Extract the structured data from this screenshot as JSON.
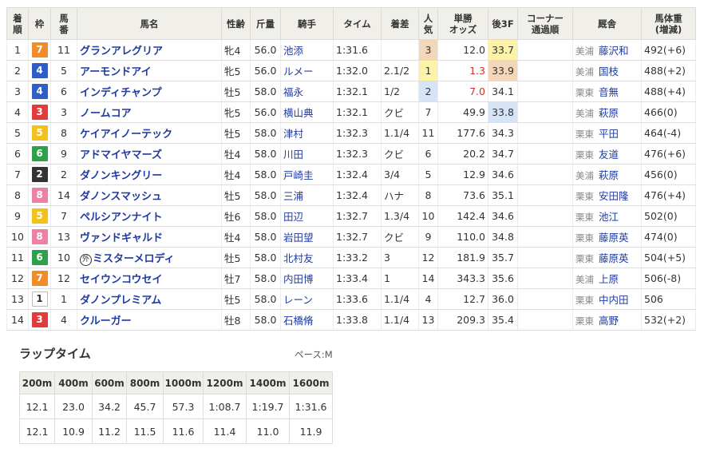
{
  "columns": [
    "着順",
    "枠",
    "馬番",
    "馬名",
    "性齢",
    "斤量",
    "騎手",
    "タイム",
    "着差",
    "人気",
    "単勝オッズ",
    "後3F",
    "コーナー通過順",
    "厩舎",
    "馬体重(増減)"
  ],
  "header_lines": {
    "rank": [
      "着",
      "順"
    ],
    "waku": [
      "枠"
    ],
    "umaban": [
      "馬",
      "番"
    ],
    "horse": [
      "馬名"
    ],
    "sex_age": [
      "性齢"
    ],
    "weight": [
      "斤量"
    ],
    "jockey": [
      "騎手"
    ],
    "time": [
      "タイム"
    ],
    "margin": [
      "着差"
    ],
    "pop": [
      "人",
      "気"
    ],
    "odds": [
      "単勝",
      "オッズ"
    ],
    "last3f": [
      "後3F"
    ],
    "corner": [
      "コーナー",
      "通過順"
    ],
    "trainer": [
      "厩舎"
    ],
    "body": [
      "馬体重",
      "(増減)"
    ]
  },
  "rows": [
    {
      "rank": "1",
      "waku": "7",
      "umaban": "11",
      "horse": "グランアレグリア",
      "marker": "",
      "sex_age": "牝4",
      "weight": "56.0",
      "jockey": "池添",
      "time": "1:31.6",
      "margin": "",
      "pop": "3",
      "odds": "12.0",
      "last3f": "33.7",
      "corner": "",
      "loc": "美浦",
      "trainer": "藤沢和",
      "body": "492(+6)"
    },
    {
      "rank": "2",
      "waku": "4",
      "umaban": "5",
      "horse": "アーモンドアイ",
      "marker": "",
      "sex_age": "牝5",
      "weight": "56.0",
      "jockey": "ルメー",
      "time": "1:32.0",
      "margin": "2.1/2",
      "pop": "1",
      "odds": "1.3",
      "last3f": "33.9",
      "corner": "",
      "loc": "美浦",
      "trainer": "国枝",
      "body": "488(+2)"
    },
    {
      "rank": "3",
      "waku": "4",
      "umaban": "6",
      "horse": "インディチャンプ",
      "marker": "",
      "sex_age": "牡5",
      "weight": "58.0",
      "jockey": "福永",
      "time": "1:32.1",
      "margin": "1/2",
      "pop": "2",
      "odds": "7.0",
      "last3f": "34.1",
      "corner": "",
      "loc": "栗東",
      "trainer": "音無",
      "body": "488(+4)"
    },
    {
      "rank": "4",
      "waku": "3",
      "umaban": "3",
      "horse": "ノームコア",
      "marker": "",
      "sex_age": "牝5",
      "weight": "56.0",
      "jockey": "横山典",
      "time": "1:32.1",
      "margin": "クビ",
      "pop": "7",
      "odds": "49.9",
      "last3f": "33.8",
      "corner": "",
      "loc": "美浦",
      "trainer": "萩原",
      "body": "466(0)"
    },
    {
      "rank": "5",
      "waku": "5",
      "umaban": "8",
      "horse": "ケイアイノーテック",
      "marker": "",
      "sex_age": "牡5",
      "weight": "58.0",
      "jockey": "津村",
      "time": "1:32.3",
      "margin": "1.1/4",
      "pop": "11",
      "odds": "177.6",
      "last3f": "34.3",
      "corner": "",
      "loc": "栗東",
      "trainer": "平田",
      "body": "464(-4)"
    },
    {
      "rank": "6",
      "waku": "6",
      "umaban": "9",
      "horse": "アドマイヤマーズ",
      "marker": "",
      "sex_age": "牡4",
      "weight": "58.0",
      "jockey": "川田",
      "time": "1:32.3",
      "margin": "クビ",
      "pop": "6",
      "odds": "20.2",
      "last3f": "34.7",
      "corner": "",
      "loc": "栗東",
      "trainer": "友道",
      "body": "476(+6)"
    },
    {
      "rank": "7",
      "waku": "2",
      "umaban": "2",
      "horse": "ダノンキングリー",
      "marker": "",
      "sex_age": "牡4",
      "weight": "58.0",
      "jockey": "戸崎圭",
      "time": "1:32.4",
      "margin": "3/4",
      "pop": "5",
      "odds": "12.9",
      "last3f": "34.6",
      "corner": "",
      "loc": "美浦",
      "trainer": "萩原",
      "body": "456(0)"
    },
    {
      "rank": "8",
      "waku": "8",
      "umaban": "14",
      "horse": "ダノンスマッシュ",
      "marker": "",
      "sex_age": "牡5",
      "weight": "58.0",
      "jockey": "三浦",
      "time": "1:32.4",
      "margin": "ハナ",
      "pop": "8",
      "odds": "73.6",
      "last3f": "35.1",
      "corner": "",
      "loc": "栗東",
      "trainer": "安田隆",
      "body": "476(+4)"
    },
    {
      "rank": "9",
      "waku": "5",
      "umaban": "7",
      "horse": "ペルシアンナイト",
      "marker": "",
      "sex_age": "牡6",
      "weight": "58.0",
      "jockey": "田辺",
      "time": "1:32.7",
      "margin": "1.3/4",
      "pop": "10",
      "odds": "142.4",
      "last3f": "34.6",
      "corner": "",
      "loc": "栗東",
      "trainer": "池江",
      "body": "502(0)"
    },
    {
      "rank": "10",
      "waku": "8",
      "umaban": "13",
      "horse": "ヴァンドギャルド",
      "marker": "",
      "sex_age": "牡4",
      "weight": "58.0",
      "jockey": "岩田望",
      "time": "1:32.7",
      "margin": "クビ",
      "pop": "9",
      "odds": "110.0",
      "last3f": "34.8",
      "corner": "",
      "loc": "栗東",
      "trainer": "藤原英",
      "body": "474(0)"
    },
    {
      "rank": "11",
      "waku": "6",
      "umaban": "10",
      "horse": "ミスターメロディ",
      "marker": "外",
      "sex_age": "牡5",
      "weight": "58.0",
      "jockey": "北村友",
      "time": "1:33.2",
      "margin": "3",
      "pop": "12",
      "odds": "181.9",
      "last3f": "35.7",
      "corner": "",
      "loc": "栗東",
      "trainer": "藤原英",
      "body": "504(+5)"
    },
    {
      "rank": "12",
      "waku": "7",
      "umaban": "12",
      "horse": "セイウンコウセイ",
      "marker": "",
      "sex_age": "牡7",
      "weight": "58.0",
      "jockey": "内田博",
      "time": "1:33.4",
      "margin": "1",
      "pop": "14",
      "odds": "343.3",
      "last3f": "35.6",
      "corner": "",
      "loc": "美浦",
      "trainer": "上原",
      "body": "506(-8)"
    },
    {
      "rank": "13",
      "waku": "1",
      "umaban": "1",
      "horse": "ダノンプレミアム",
      "marker": "",
      "sex_age": "牡5",
      "weight": "58.0",
      "jockey": "レーン",
      "time": "1:33.6",
      "margin": "1.1/4",
      "pop": "4",
      "odds": "12.7",
      "last3f": "36.0",
      "corner": "",
      "loc": "栗東",
      "trainer": "中内田",
      "body": "506"
    },
    {
      "rank": "14",
      "waku": "3",
      "umaban": "4",
      "horse": "クルーガー",
      "marker": "",
      "sex_age": "牡8",
      "weight": "58.0",
      "jockey": "石橋脩",
      "time": "1:33.8",
      "margin": "1.1/4",
      "pop": "13",
      "odds": "209.3",
      "last3f": "35.4",
      "corner": "",
      "loc": "栗東",
      "trainer": "高野",
      "body": "532(+2)"
    }
  ],
  "lap": {
    "title": "ラップタイム",
    "pace": "ペース:M",
    "distances": [
      "200m",
      "400m",
      "600m",
      "800m",
      "1000m",
      "1200m",
      "1400m",
      "1600m"
    ],
    "cumulative": [
      "12.1",
      "23.0",
      "34.2",
      "45.7",
      "57.3",
      "1:08.7",
      "1:19.7",
      "1:31.6"
    ],
    "splits": [
      "12.1",
      "10.9",
      "11.2",
      "11.5",
      "11.6",
      "11.4",
      "11.0",
      "11.9"
    ]
  },
  "colors": {
    "waku1": "#ffffff",
    "waku2": "#333333",
    "waku3": "#e23b3b",
    "waku4": "#2e5fc7",
    "waku5": "#f2c21b",
    "waku6": "#2da14a",
    "waku7": "#f08c29",
    "waku8": "#f07fa4",
    "link": "#1f3aa0",
    "header_bg": "#f1efe9",
    "pop1": "#fdf3a6",
    "pop2": "#d6e4f7",
    "pop3": "#f4d6b9"
  }
}
